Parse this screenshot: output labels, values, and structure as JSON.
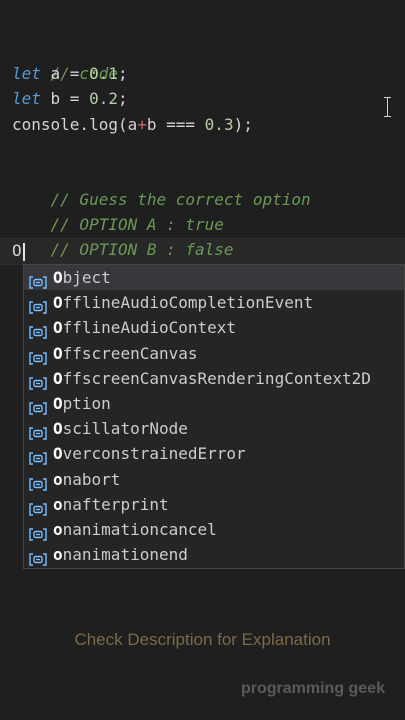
{
  "editor": {
    "lines": {
      "comment_code": "// code",
      "let_a": {
        "kw": "let",
        "rest": " a = ",
        "num": "0.1",
        "end": ";"
      },
      "let_b": {
        "kw": "let",
        "rest": " b = ",
        "num": "0.2",
        "end": ";"
      },
      "console": {
        "pre": "console.log(a",
        "plus": "+",
        "mid": "b === ",
        "num": "0.3",
        "end": ");"
      },
      "comment_guess": "// Guess the correct option",
      "comment_option_a": "// OPTION A : true",
      "comment_option_b": "// OPTION B : false",
      "typed": "O"
    },
    "colors": {
      "background": "#1f1f1f",
      "comment": "#6a9955",
      "keyword": "#569cd6",
      "number": "#b5cea8",
      "icon": "#75beff"
    }
  },
  "suggestions": {
    "icon": "variable-icon",
    "items": [
      {
        "match": "O",
        "rest": "bject"
      },
      {
        "match": "O",
        "rest": "fflineAudioCompletionEvent"
      },
      {
        "match": "O",
        "rest": "fflineAudioContext"
      },
      {
        "match": "O",
        "rest": "ffscreenCanvas"
      },
      {
        "match": "O",
        "rest": "ffscreenCanvasRenderingContext2D"
      },
      {
        "match": "O",
        "rest": "ption"
      },
      {
        "match": "O",
        "rest": "scillatorNode"
      },
      {
        "match": "O",
        "rest": "verconstrainedError"
      },
      {
        "match": "o",
        "rest": "nabort"
      },
      {
        "match": "o",
        "rest": "nafterprint"
      },
      {
        "match": "o",
        "rest": "nanimationcancel"
      },
      {
        "match": "o",
        "rest": "nanimationend"
      }
    ]
  },
  "footer": {
    "caption": "Check Description for Explanation",
    "watermark": "programming geek"
  }
}
